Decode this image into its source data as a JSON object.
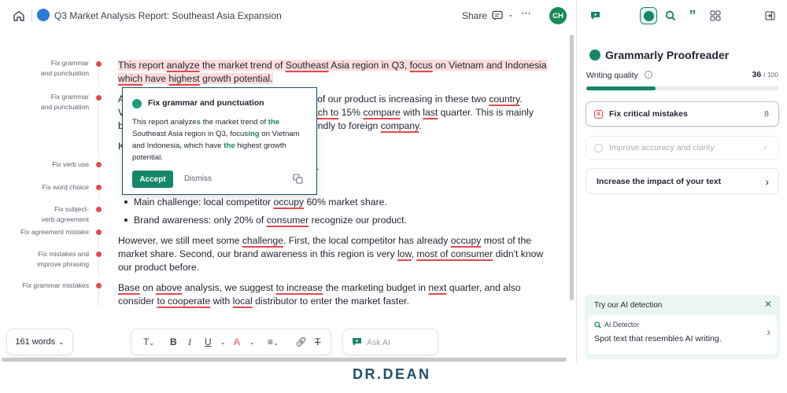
{
  "topbar": {
    "doc_title": "Q3 Market Analysis Report: Southeast Asia Expansion",
    "share_label": "Share",
    "avatar_initials": "CH"
  },
  "annotations": [
    {
      "label": "Fix grammar\nand punctuation"
    },
    {
      "label": "Fix grammar\nand punctuation"
    },
    {
      "label": "Fix verb use"
    },
    {
      "label": "Fix word choice"
    },
    {
      "label": "Fix subject-\nverb agreement"
    },
    {
      "label": "Fix agreement mistake"
    },
    {
      "label": "Fix mistakes and\nimprove phrasing"
    },
    {
      "label": "Fix grammar mistakes"
    }
  ],
  "document": {
    "p1_l1": [
      "This report ",
      "analyze",
      " the market trend of ",
      "Southeast",
      " Asia region in Q3, ",
      "focus",
      " on Vietnam and Indonesia"
    ],
    "p1_l2": [
      "which",
      " have ",
      "highest",
      " growth potential."
    ],
    "p2_l1_frag": [
      "A",
      "l of our product is increasing in these two ",
      "country",
      "."
    ],
    "p2_l2_frag": [
      "V",
      "ach to",
      " 15% ",
      "compare",
      " with ",
      "last",
      " quarter. This is mainly"
    ],
    "p2_l3_frag": [
      "b",
      "endly to foreign ",
      "company",
      "."
    ],
    "p3_frag": [
      "K"
    ],
    "p4_frag": [
      ")."
    ],
    "bullet1": [
      "Main challenge: local competitor ",
      "occupy",
      " 60% market share."
    ],
    "bullet2": [
      "Brand awareness: only 20% of ",
      "consumer",
      " recognize our product."
    ],
    "p5_l1": [
      "However, we still meet some ",
      "challenge",
      ". First, the local competitor has already ",
      "occupy",
      " most of the"
    ],
    "p5_l2": [
      "market share. Second, our brand awareness in this region is very ",
      "low",
      ", ",
      "most of consumer",
      " didn't know"
    ],
    "p5_l3": [
      "our product before."
    ],
    "p6_l1": [
      "Base",
      " on ",
      "above",
      " analysis, we suggest ",
      "to increase",
      " the marketing budget in ",
      "next",
      " quarter, and also"
    ],
    "p6_l2": [
      "consider ",
      "to cooperate",
      " with ",
      "local",
      " distributor to enter the market faster."
    ]
  },
  "popup": {
    "title": "Fix grammar and punctuation",
    "body": [
      {
        "t": "This report analyze",
        "b": false
      },
      {
        "t": "s",
        "b": true
      },
      {
        "t": " the market trend of ",
        "b": false
      },
      {
        "t": "the",
        "b": true
      },
      {
        "t": " Southeast Asia region in Q3, focus",
        "b": false
      },
      {
        "t": "ing",
        "b": true
      },
      {
        "t": " on Vietnam and Indonesia",
        "b": false
      },
      {
        "t": ",",
        "b": true
      },
      {
        "t": " which have ",
        "b": false
      },
      {
        "t": "the",
        "b": true
      },
      {
        "t": " highest growth potential.",
        "b": false
      }
    ],
    "accept_label": "Accept",
    "dismiss_label": "Dismiss"
  },
  "toolbar": {
    "word_count": "161 words",
    "ask_ai_placeholder": "Ask AI"
  },
  "panel": {
    "title": "Grammarly Proofreader",
    "writing_quality_label": "Writing quality",
    "score": "36",
    "score_total": "/ 100",
    "score_fraction": 0.36,
    "cards": [
      {
        "label": "Fix critical mistakes",
        "count": "8"
      },
      {
        "label": "Improve accuracy and clarity"
      },
      {
        "label": "Increase the impact of your text"
      }
    ],
    "ai_box": {
      "title": "Try our AI detection",
      "tool_name": "AI Detector",
      "description": "Spot text that resembles AI writing."
    }
  },
  "watermark": "DR.DEAN",
  "colors": {
    "error_red": "#e5484d",
    "accent_green": "#14866a",
    "highlight_pink": "#fbdcdc"
  }
}
